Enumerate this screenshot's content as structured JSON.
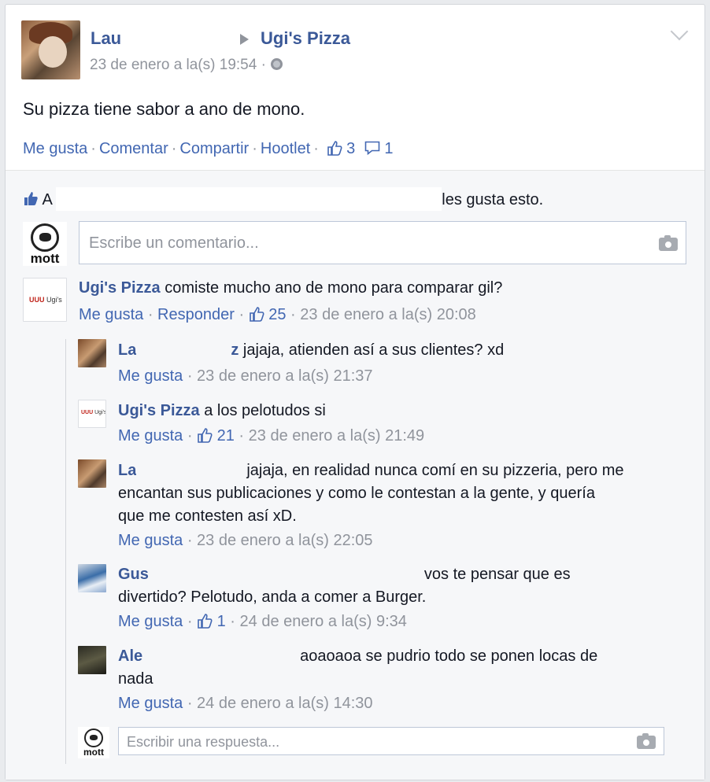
{
  "post": {
    "author": "Lau",
    "page": "Ugi's Pizza",
    "timestamp": "23 de enero a la(s) 19:54 ·",
    "text": "Su pizza tiene sabor a ano de mono.",
    "actions": {
      "like": "Me gusta",
      "comment": "Comentar",
      "share": "Compartir",
      "hootlet": "Hootlet"
    },
    "like_count": "3",
    "comment_count": "1"
  },
  "likes_summary": {
    "prefix": "A",
    "suffix": "les gusta esto."
  },
  "comment_input": {
    "placeholder": "Escribe un comentario..."
  },
  "mott_label": "mott",
  "comment": {
    "author": "Ugi's Pizza",
    "text": "comiste mucho ano de mono para comparar gil?",
    "like": "Me gusta",
    "reply": "Responder",
    "likes": "25",
    "time": "23 de enero a la(s) 20:08"
  },
  "replies": [
    {
      "author": "La",
      "author_tail": "z",
      "text": "jajaja, atienden así a sus clientes? xd",
      "like": "Me gusta",
      "likes": "",
      "time": "23 de enero a la(s) 21:37"
    },
    {
      "author": "Ugi's Pizza",
      "text": "a los pelotudos si",
      "like": "Me gusta",
      "likes": "21",
      "time": "23 de enero a la(s) 21:49"
    },
    {
      "author": "La",
      "text": "jajaja, en realidad nunca comí en su pizzeria, pero me",
      "text2": "encantan sus publicaciones y como le contestan a la gente, y quería",
      "text3": "que me contesten así xD.",
      "like": "Me gusta",
      "likes": "",
      "time": "23 de enero a la(s) 22:05"
    },
    {
      "author": "Gus",
      "text": "vos te pensar que es",
      "text2": "divertido? Pelotudo, anda a comer a Burger.",
      "like": "Me gusta",
      "likes": "1",
      "time": "24 de enero a la(s) 9:34"
    },
    {
      "author": "Ale",
      "text": "aoaoaoa se pudrio todo se ponen locas de",
      "text2": "nada",
      "like": "Me gusta",
      "likes": "",
      "time": "24 de enero a la(s) 14:30"
    }
  ],
  "ugi_logo": {
    "mark": "UUU",
    "text": "Ugi's"
  },
  "reply_input": {
    "placeholder": "Escribir una respuesta..."
  },
  "colors": {
    "link": "#3b5998",
    "meta": "#90949c",
    "action": "#4267b2"
  }
}
